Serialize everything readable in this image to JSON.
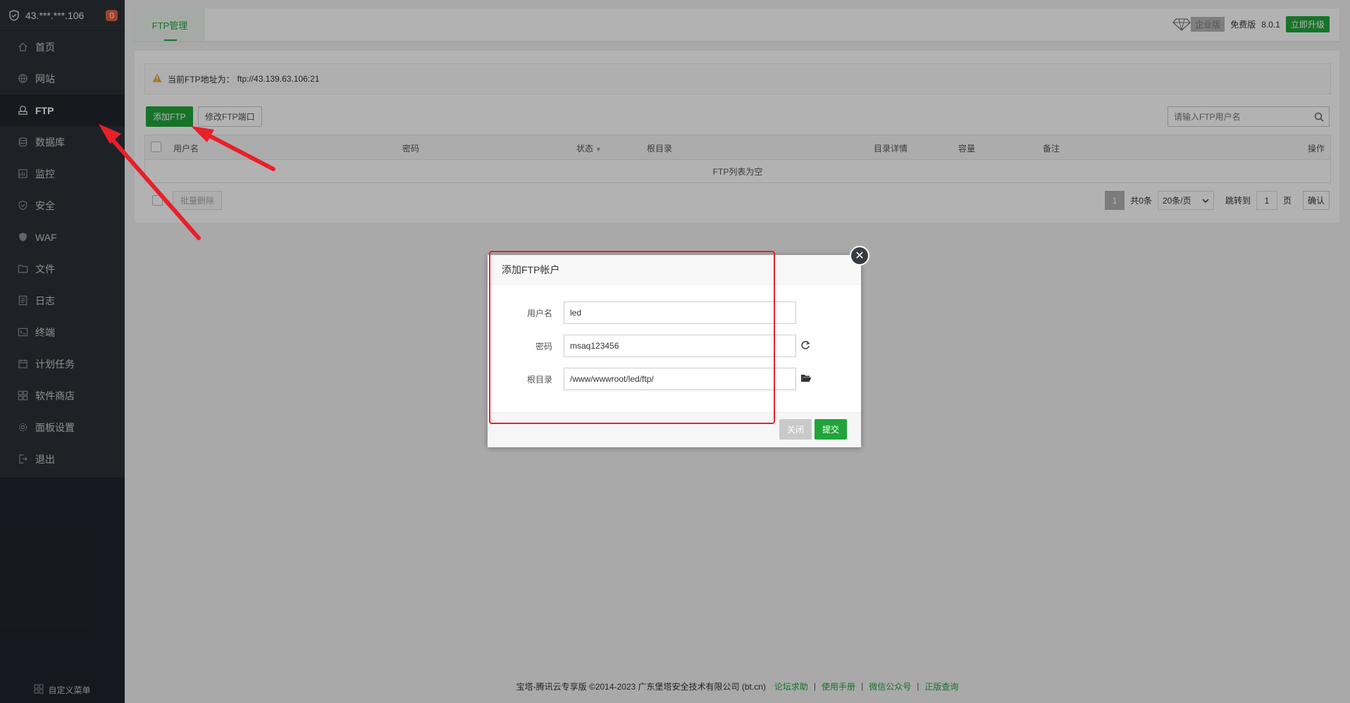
{
  "sidebar": {
    "server_ip": "43.***.***.106",
    "badge": "0",
    "items": [
      {
        "label": "首页",
        "icon": "home-icon"
      },
      {
        "label": "网站",
        "icon": "globe-icon"
      },
      {
        "label": "FTP",
        "icon": "ftp-icon",
        "active": true
      },
      {
        "label": "数据库",
        "icon": "database-icon"
      },
      {
        "label": "监控",
        "icon": "monitor-icon"
      },
      {
        "label": "安全",
        "icon": "shield-icon"
      },
      {
        "label": "WAF",
        "icon": "waf-icon"
      },
      {
        "label": "文件",
        "icon": "folder-icon"
      },
      {
        "label": "日志",
        "icon": "log-icon"
      },
      {
        "label": "终端",
        "icon": "terminal-icon"
      },
      {
        "label": "计划任务",
        "icon": "calendar-icon"
      },
      {
        "label": "软件商店",
        "icon": "apps-icon"
      },
      {
        "label": "面板设置",
        "icon": "gear-icon"
      },
      {
        "label": "退出",
        "icon": "logout-icon"
      }
    ],
    "custom_menu": "自定义菜单"
  },
  "topbar": {
    "tab": "FTP管理",
    "edition": "企业版",
    "free": "免费版",
    "version": "8.0.1",
    "upgrade": "立即升级"
  },
  "notice": {
    "label": "当前FTP地址为：",
    "address": "ftp://43.139.63.106:21"
  },
  "toolbar": {
    "add": "添加FTP",
    "port": "修改FTP端口",
    "search_placeholder": "请输入FTP用户名"
  },
  "table": {
    "headers": [
      "用户名",
      "密码",
      "状态",
      "根目录",
      "目录详情",
      "容量",
      "备注",
      "操作"
    ],
    "empty": "FTP列表为空"
  },
  "batch_delete": "批量删除",
  "pager": {
    "current": "1",
    "total": "共0条",
    "per_page": "20条/页",
    "jump_label": "跳转到",
    "jump_value": "1",
    "page_unit": "页",
    "confirm": "确认"
  },
  "footer": {
    "copyright": "宝塔-腾讯云专享版 ©2014-2023 广东堡塔安全技术有限公司 (bt.cn)",
    "links": [
      "论坛求助",
      "使用手册",
      "微信公众号",
      "正版查询"
    ]
  },
  "dialog": {
    "title": "添加FTP帐户",
    "fields": [
      {
        "label": "用户名",
        "value": "led"
      },
      {
        "label": "密码",
        "value": "msaq123456"
      },
      {
        "label": "根目录",
        "value": "/www/wwwroot/led/ftp/"
      }
    ],
    "cancel": "关闭",
    "submit": "提交"
  },
  "colors": {
    "accent": "#20a53a",
    "sidebar_bg": "#2c3138",
    "annotation_red": "#e8202a"
  }
}
